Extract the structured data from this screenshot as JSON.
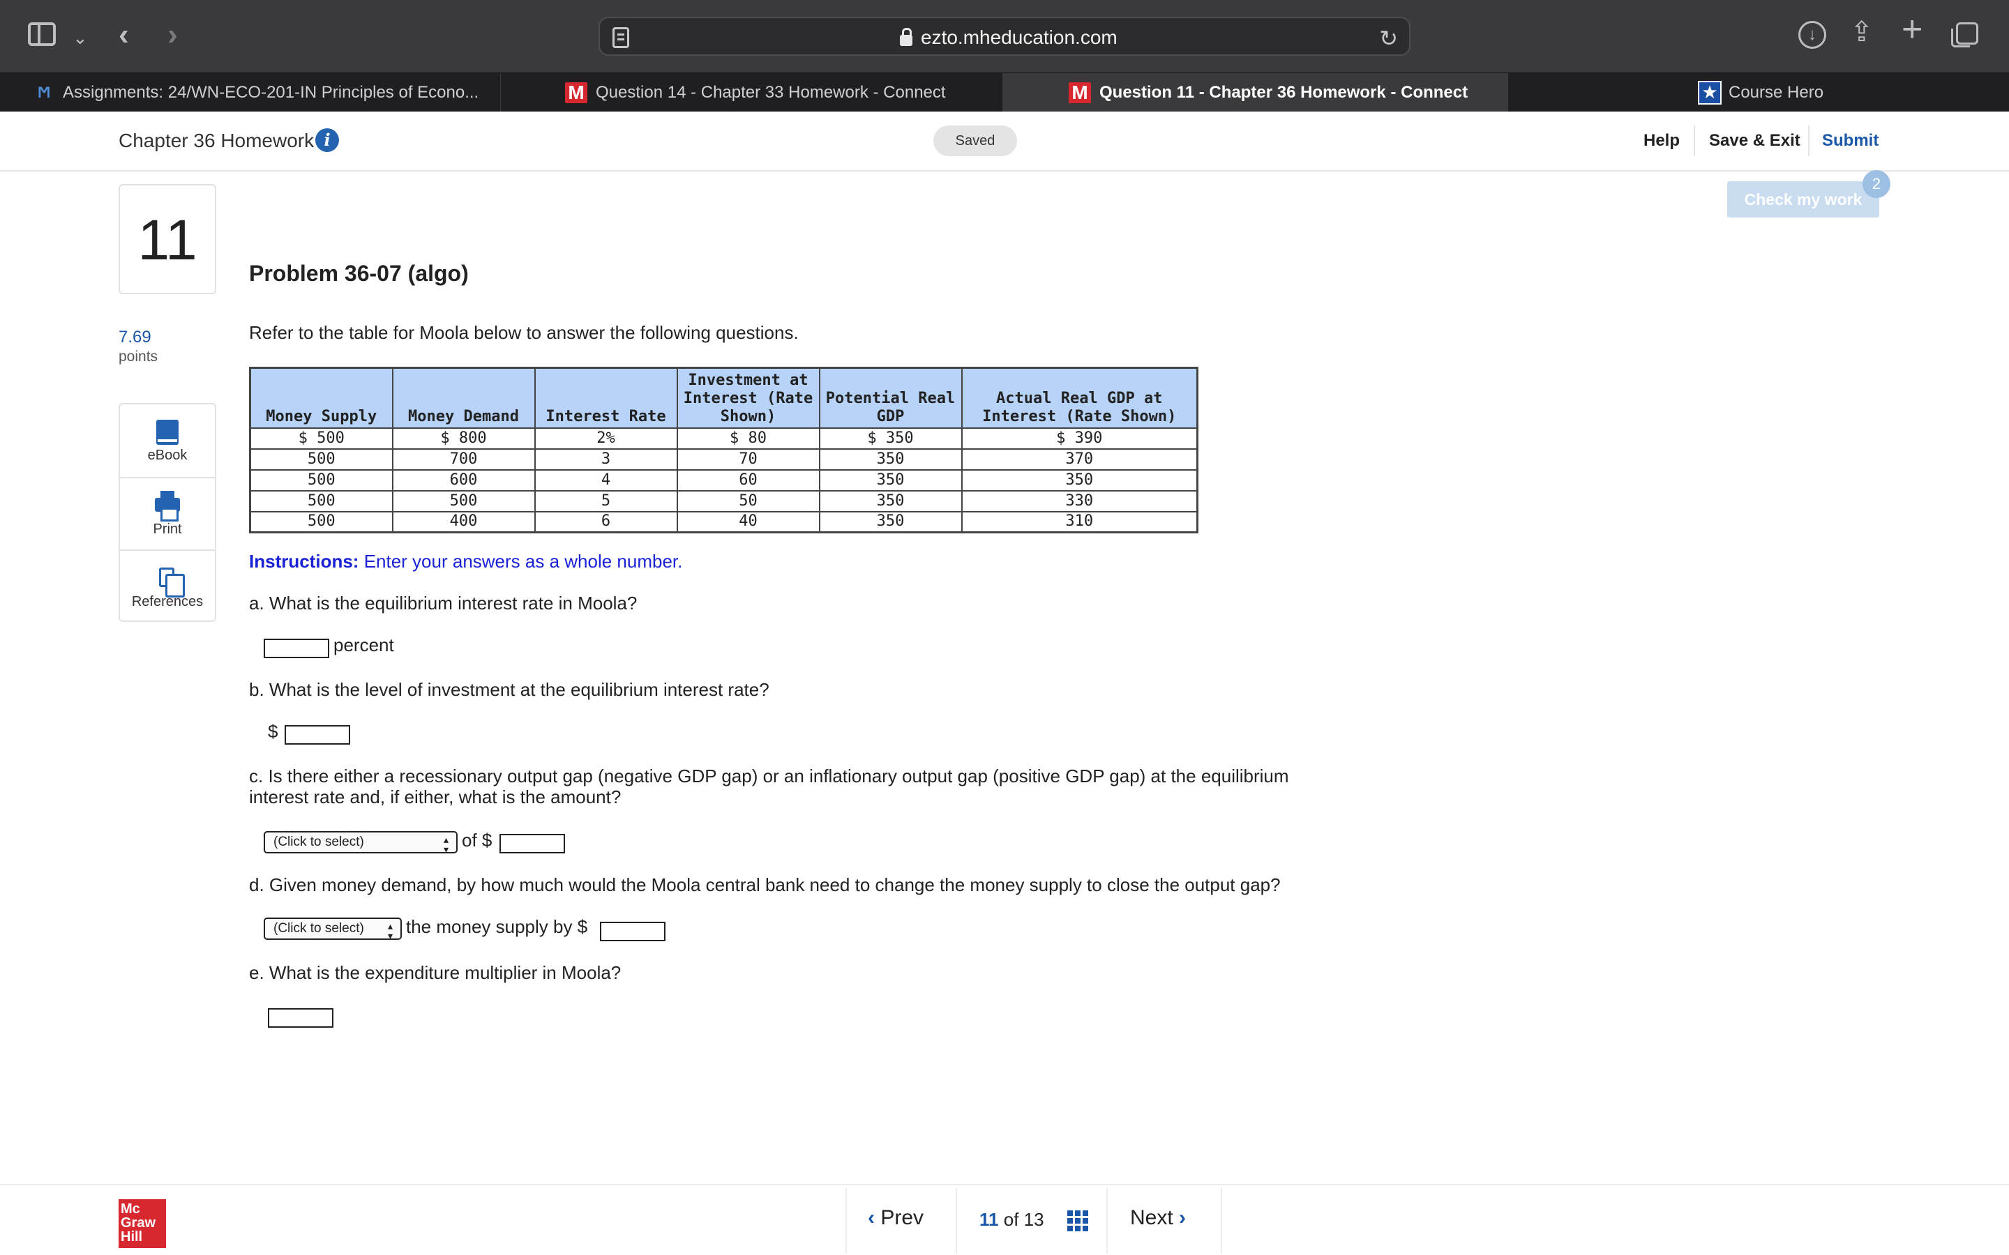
{
  "browser": {
    "url": "ezto.mheducation.com",
    "tabs": [
      {
        "label": "Assignments: 24/WN-ECO-201-IN Principles of Econo...",
        "favicon": "mh-icon"
      },
      {
        "label": "Question 14 - Chapter 33 Homework - Connect",
        "favicon": "M"
      },
      {
        "label": "Question 11 - Chapter 36 Homework - Connect",
        "favicon": "M",
        "active": true
      },
      {
        "label": "Course Hero",
        "favicon": "course-hero-icon"
      }
    ]
  },
  "header": {
    "title": "Chapter 36 Homework",
    "info_icon": "i",
    "status": "Saved",
    "help": "Help",
    "save_exit": "Save & Exit",
    "submit": "Submit"
  },
  "check_my_work": {
    "label": "Check my work",
    "badge": "2"
  },
  "question": {
    "number": "11",
    "points_value": "7.69",
    "points_label": "points",
    "title": "Problem 36-07 (algo)",
    "intro": "Refer to the table for Moola below to answer the following questions."
  },
  "tools": [
    {
      "label": "eBook",
      "icon": "book-icon"
    },
    {
      "label": "Print",
      "icon": "printer-icon"
    },
    {
      "label": "References",
      "icon": "references-icon"
    }
  ],
  "table": {
    "headers": [
      "Money Supply",
      "Money Demand",
      "Interest Rate",
      "Investment at Interest (Rate Shown)",
      "Potential Real GDP",
      "Actual Real GDP at Interest (Rate Shown)"
    ],
    "rows": [
      [
        "$ 500",
        "$ 800",
        "2%",
        "$ 80",
        "$ 350",
        "$ 390"
      ],
      [
        "500",
        "700",
        "3",
        "70",
        "350",
        "370"
      ],
      [
        "500",
        "600",
        "4",
        "60",
        "350",
        "350"
      ],
      [
        "500",
        "500",
        "5",
        "50",
        "350",
        "330"
      ],
      [
        "500",
        "400",
        "6",
        "40",
        "350",
        "310"
      ]
    ]
  },
  "instructions": {
    "label": "Instructions:",
    "text": "Enter your answers as a whole number."
  },
  "parts": {
    "a": {
      "question": "a. What is the equilibrium interest rate in Moola?",
      "suffix": "percent",
      "value": ""
    },
    "b": {
      "question": "b. What is the level of investment at the equilibrium interest rate?",
      "prefix": "$",
      "value": ""
    },
    "c": {
      "question": "c. Is there either a recessionary output gap (negative GDP gap) or an inflationary output gap (positive GDP gap) at the equilibrium interest rate and, if either, what is the amount?",
      "select": "(Click to select)",
      "mid": "of $",
      "value": ""
    },
    "d": {
      "question": "d. Given money demand, by how much would the Moola central bank need to change the money supply to close the output gap?",
      "select": "(Click to select)",
      "mid": "the money supply by $",
      "value": ""
    },
    "e": {
      "question": "e. What is the expenditure multiplier in Moola?",
      "value": ""
    }
  },
  "footer": {
    "logo": "Mc Graw Hill",
    "prev": "Prev",
    "current": "11",
    "of": "of",
    "total": "13",
    "next": "Next"
  }
}
